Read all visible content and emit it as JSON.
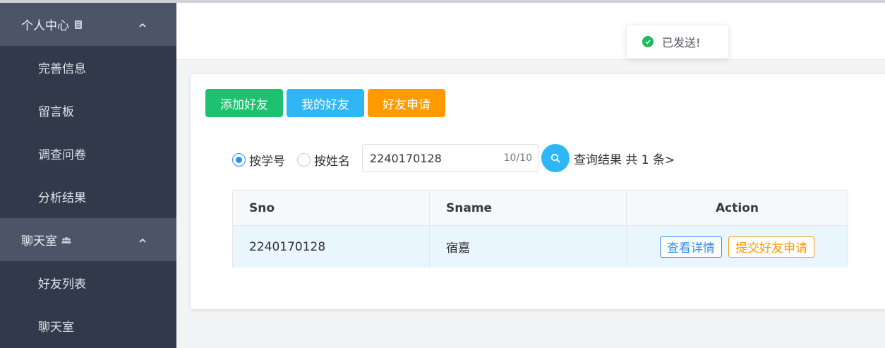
{
  "sidebar": {
    "personal": {
      "label": "个人中心"
    },
    "personal_items": [
      {
        "label": "完善信息"
      },
      {
        "label": "留言板"
      },
      {
        "label": "调查问卷"
      },
      {
        "label": "分析结果"
      }
    ],
    "chat": {
      "label": "聊天室"
    },
    "chat_items": [
      {
        "label": "好友列表"
      },
      {
        "label": "聊天室"
      }
    ]
  },
  "toast": {
    "message": "已发送!"
  },
  "toolbar": {
    "add_friend": "添加好友",
    "my_friends": "我的好友",
    "friend_requests": "好友申请"
  },
  "search": {
    "radio_sno": "按学号",
    "radio_name": "按姓名",
    "selected": "按学号",
    "value": "2240170128",
    "char_count": "10/10",
    "result_text": "查询结果 共 1 条>"
  },
  "table": {
    "columns": [
      "Sno",
      "Sname",
      "Action"
    ],
    "rows": [
      {
        "sno": "2240170128",
        "sname": "宿嘉",
        "detail_label": "查看详情",
        "apply_label": "提交好友申请"
      }
    ]
  },
  "colors": {
    "sidebar_bg": "#313a4a",
    "sidebar_header_bg": "#4c5467",
    "green": "#1ec16f",
    "blue": "#2fb7f5",
    "orange": "#ff9a00",
    "primary": "#2d8cf0",
    "success": "#1eb961"
  },
  "icons": [
    "book-icon",
    "chevron-up-icon",
    "users-icon",
    "check-circle-icon",
    "search-icon"
  ]
}
